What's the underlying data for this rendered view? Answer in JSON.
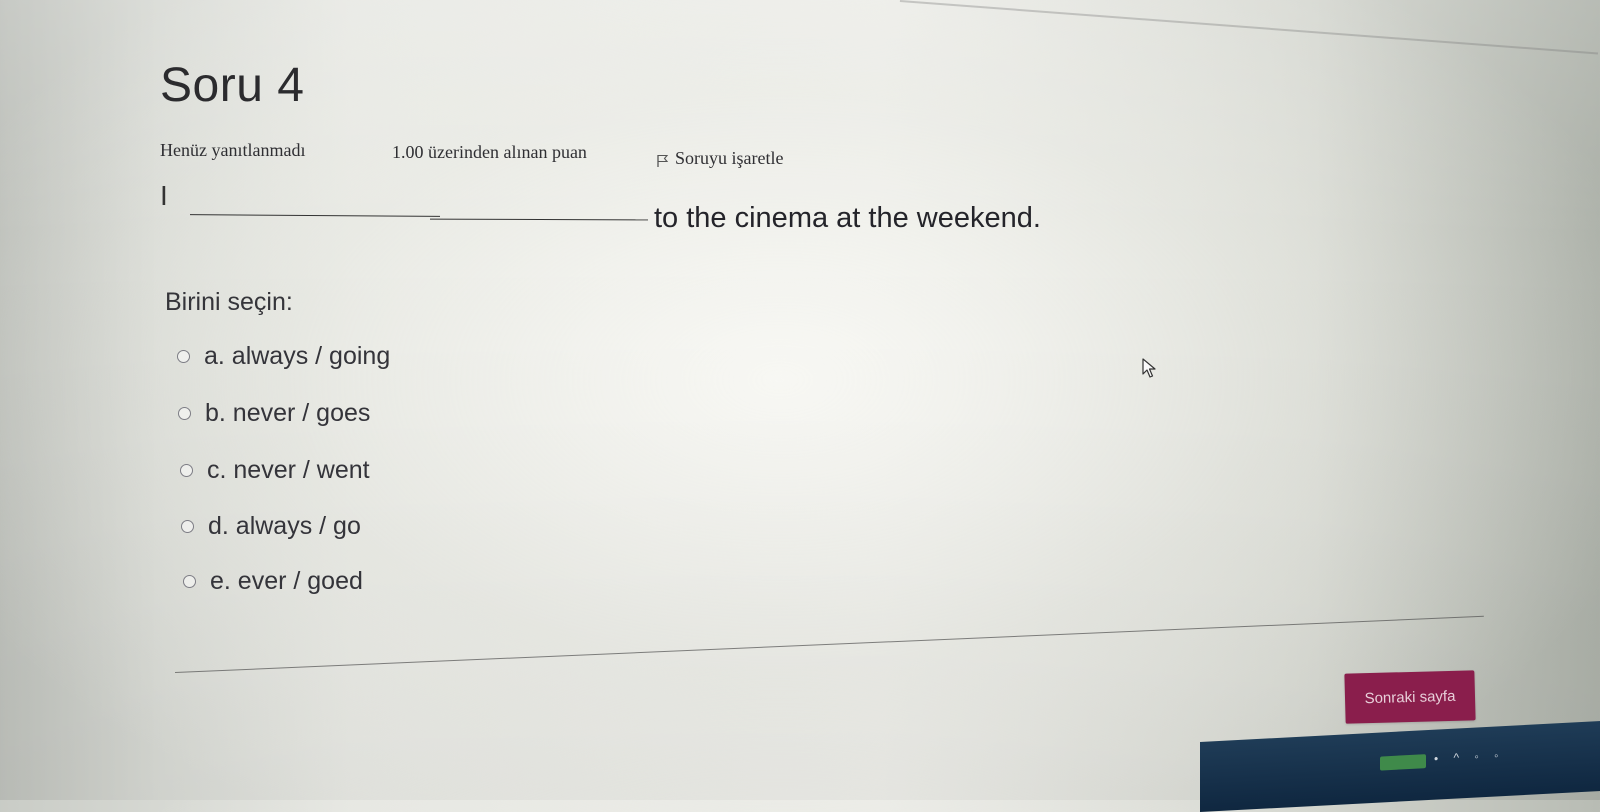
{
  "question": {
    "title": "Soru 4",
    "status": "Henüz yanıtlanmadı",
    "points": "1.00 üzerinden alınan puan",
    "flag_label": "Soruyu işaretle",
    "flag_icon": "flag-icon",
    "sentence_start": "I",
    "sentence_end": "to the cinema at the weekend."
  },
  "prompt": "Birini seçin:",
  "answers": [
    {
      "label": "a. always / going",
      "selected": false
    },
    {
      "label": "b. never / goes",
      "selected": false
    },
    {
      "label": "c. never / went",
      "selected": false
    },
    {
      "label": "d. always / go",
      "selected": false
    },
    {
      "label": "e. ever / goed",
      "selected": false
    }
  ],
  "navigation": {
    "next_label": "Sonraki sayfa"
  },
  "colors": {
    "accent": "#8a1e4c",
    "text": "#34343a",
    "taskbar": "#1f3c57"
  }
}
